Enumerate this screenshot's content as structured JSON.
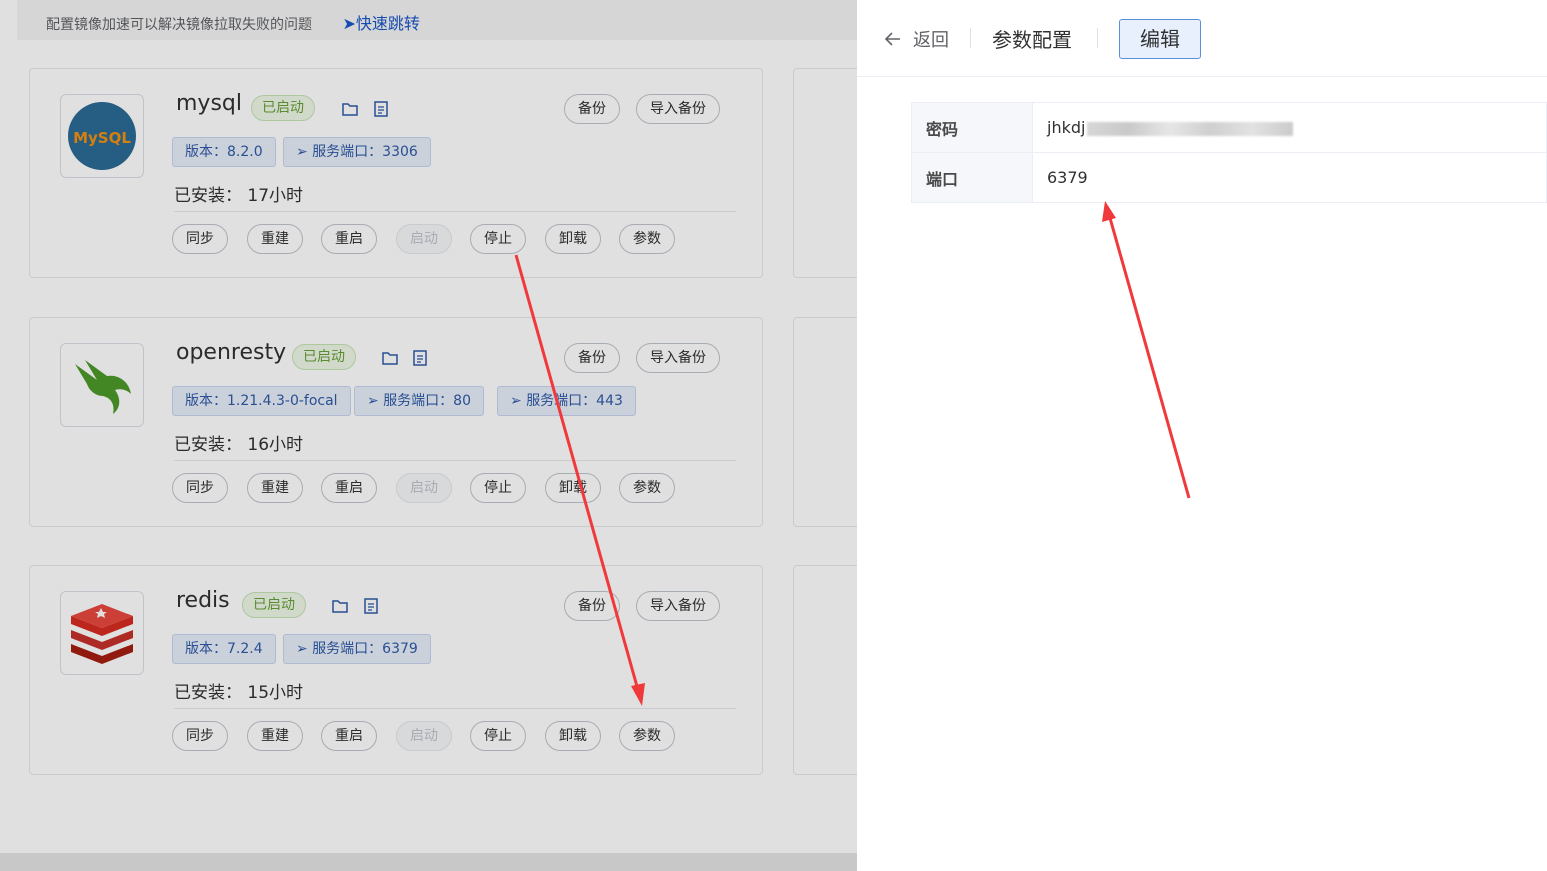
{
  "notice": {
    "text": "配置镜像加速可以解决镜像拉取失败的问题",
    "jump_label": "快速跳转"
  },
  "apps": [
    {
      "name": "mysql",
      "status": "已启动",
      "tags": [
        "版本：8.2.0",
        "服务端口：3306"
      ],
      "installed_label": "已安装：",
      "installed_value": "17小时",
      "backup_label": "备份",
      "import_label": "导入备份",
      "logo_text": "MySQL"
    },
    {
      "name": "openresty",
      "status": "已启动",
      "tags": [
        "版本：1.21.4.3-0-focal",
        "服务端口：80",
        "服务端口：443"
      ],
      "installed_label": "已安装：",
      "installed_value": "16小时",
      "backup_label": "备份",
      "import_label": "导入备份",
      "logo_text": ""
    },
    {
      "name": "redis",
      "status": "已启动",
      "tags": [
        "版本：7.2.4",
        "服务端口：6379"
      ],
      "installed_label": "已安装：",
      "installed_value": "15小时",
      "backup_label": "备份",
      "import_label": "导入备份",
      "logo_text": ""
    }
  ],
  "ops": [
    "同步",
    "重建",
    "重启",
    "启动",
    "停止",
    "卸载",
    "参数"
  ],
  "ops_disabled": [
    "启动"
  ],
  "drawer": {
    "back_label": "返回",
    "title": "参数配置",
    "edit_label": "编辑",
    "params": [
      {
        "key": "密码",
        "value": "jhkdj"
      },
      {
        "key": "端口",
        "value": "6379"
      }
    ]
  },
  "colors": {
    "accent": "#1a56c9",
    "success": "#67a03a",
    "annotation_arrow": "#f0393b"
  }
}
